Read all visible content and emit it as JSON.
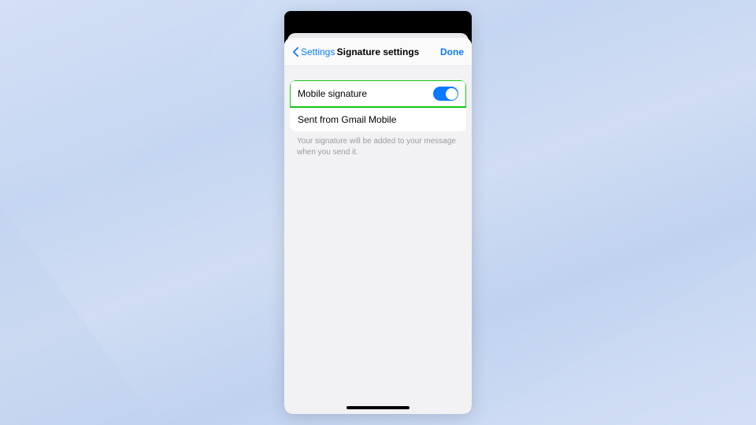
{
  "nav": {
    "back_label": "Settings",
    "title": "Signature settings",
    "done_label": "Done"
  },
  "signature": {
    "toggle_label": "Mobile signature",
    "toggle_on": true,
    "value": "Sent from Gmail Mobile",
    "help_text": "Your signature will be added to your message when you send it."
  },
  "colors": {
    "accent": "#0a7aff",
    "highlight": "#18c418"
  }
}
